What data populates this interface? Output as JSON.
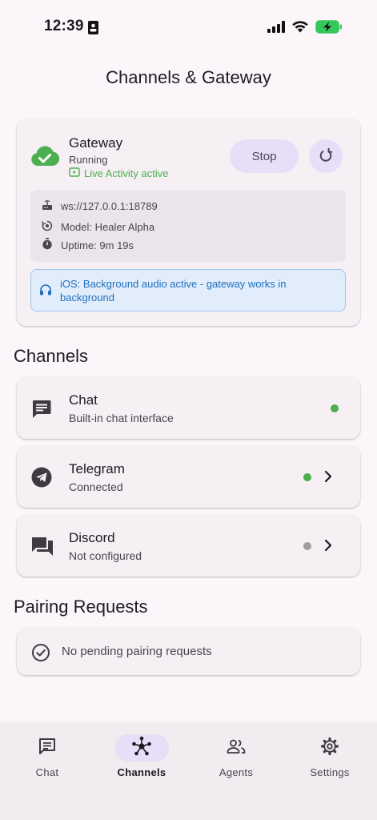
{
  "status_bar": {
    "time": "12:39"
  },
  "app": {
    "title": "Channels & Gateway"
  },
  "gateway": {
    "title": "Gateway",
    "status": "Running",
    "live_activity": "Live Activity active",
    "stop_label": "Stop",
    "url": "ws://127.0.0.1:18789",
    "model": "Model: Healer Alpha",
    "uptime": "Uptime: 9m 19s",
    "ios_notice": "iOS: Background audio active - gateway works in background"
  },
  "channels": {
    "section_title": "Channels",
    "items": [
      {
        "name": "Chat",
        "subtitle": "Built-in chat interface",
        "status": "active",
        "icon": "chat-icon"
      },
      {
        "name": "Telegram",
        "subtitle": "Connected",
        "status": "active",
        "icon": "telegram-icon"
      },
      {
        "name": "Discord",
        "subtitle": "Not configured",
        "status": "inactive",
        "icon": "discord-icon"
      }
    ]
  },
  "pairing": {
    "section_title": "Pairing Requests",
    "empty_text": "No pending pairing requests"
  },
  "nav": {
    "items": [
      {
        "label": "Chat",
        "icon": "chat-icon",
        "active": false
      },
      {
        "label": "Channels",
        "icon": "hub-icon",
        "active": true
      },
      {
        "label": "Agents",
        "icon": "people-icon",
        "active": false
      },
      {
        "label": "Settings",
        "icon": "gear-icon",
        "active": false
      }
    ]
  },
  "colors": {
    "accent": "#e8def8",
    "success": "#4caf50",
    "inactive": "#9e9e9e",
    "info": "#1e6fbf"
  }
}
